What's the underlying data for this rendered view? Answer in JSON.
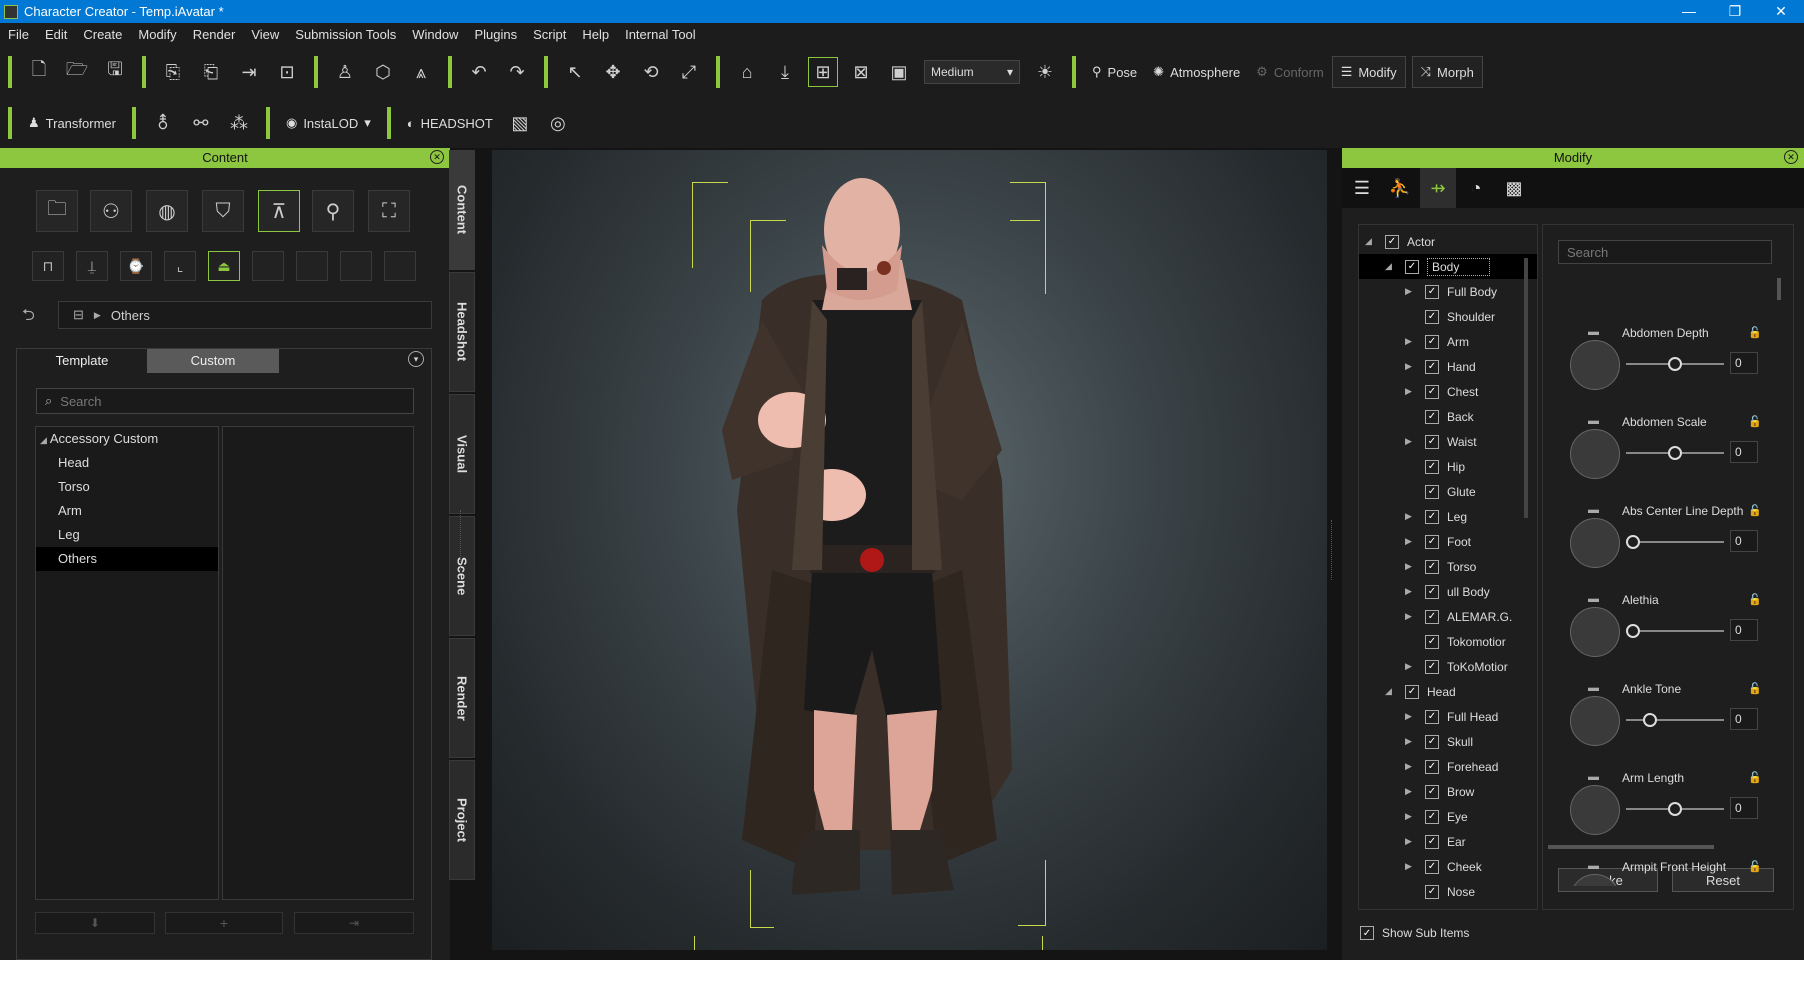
{
  "window": {
    "title": "Character Creator - Temp.iAvatar *",
    "minimize": "—",
    "maximize": "❐",
    "close": "✕"
  },
  "menu": [
    "File",
    "Edit",
    "Create",
    "Modify",
    "Render",
    "View",
    "Submission Tools",
    "Window",
    "Plugins",
    "Script",
    "Help",
    "Internal Tool"
  ],
  "toolbar1": {
    "quality_value": "Medium",
    "pose_label": "Pose",
    "atmosphere_label": "Atmosphere",
    "conform_label": "Conform",
    "modify_label": "Modify",
    "morph_label": "Morph"
  },
  "toolbar2": {
    "transformer_label": "Transformer",
    "instalod_label": "InstaLOD",
    "headshot_label": "HEADSHOT"
  },
  "content_panel": {
    "title": "Content",
    "breadcrumb": "Others",
    "tab_template": "Template",
    "tab_custom": "Custom",
    "search_placeholder": "Search",
    "tree_root": "Accessory Custom",
    "tree_items": [
      "Head",
      "Torso",
      "Arm",
      "Leg",
      "Others"
    ],
    "selected_item": "Others"
  },
  "side_tabs": [
    "Content",
    "Headshot",
    "Visual",
    "Scene",
    "Render",
    "Project"
  ],
  "modify_panel": {
    "title": "Modify",
    "search_placeholder": "Search",
    "tree": [
      {
        "label": "Actor",
        "level": 0,
        "expand": "down"
      },
      {
        "label": "Body",
        "level": 1,
        "expand": "down",
        "selected": true
      },
      {
        "label": "Full Body",
        "level": 2,
        "expand": "right"
      },
      {
        "label": "Shoulder",
        "level": 2,
        "expand": "none"
      },
      {
        "label": "Arm",
        "level": 2,
        "expand": "right"
      },
      {
        "label": "Hand",
        "level": 2,
        "expand": "right"
      },
      {
        "label": "Chest",
        "level": 2,
        "expand": "right"
      },
      {
        "label": "Back",
        "level": 2,
        "expand": "none"
      },
      {
        "label": "Waist",
        "level": 2,
        "expand": "right"
      },
      {
        "label": "Hip",
        "level": 2,
        "expand": "none"
      },
      {
        "label": "Glute",
        "level": 2,
        "expand": "none"
      },
      {
        "label": "Leg",
        "level": 2,
        "expand": "right"
      },
      {
        "label": "Foot",
        "level": 2,
        "expand": "right"
      },
      {
        "label": "Torso",
        "level": 2,
        "expand": "right"
      },
      {
        "label": "ull Body",
        "level": 2,
        "expand": "right"
      },
      {
        "label": "ALEMAR.G.",
        "level": 2,
        "expand": "right"
      },
      {
        "label": "Tokomotior",
        "level": 2,
        "expand": "none"
      },
      {
        "label": "ToKoMotior",
        "level": 2,
        "expand": "right"
      },
      {
        "label": "Head",
        "level": 1,
        "expand": "down"
      },
      {
        "label": "Full Head",
        "level": 2,
        "expand": "right"
      },
      {
        "label": "Skull",
        "level": 2,
        "expand": "right"
      },
      {
        "label": "Forehead",
        "level": 2,
        "expand": "right"
      },
      {
        "label": "Brow",
        "level": 2,
        "expand": "right"
      },
      {
        "label": "Eye",
        "level": 2,
        "expand": "right"
      },
      {
        "label": "Ear",
        "level": 2,
        "expand": "right"
      },
      {
        "label": "Cheek",
        "level": 2,
        "expand": "right"
      },
      {
        "label": "Nose",
        "level": 2,
        "expand": "none"
      }
    ],
    "sliders": [
      {
        "name": "Abdomen Depth",
        "value": "0",
        "level": 0.5
      },
      {
        "name": "Abdomen Scale",
        "value": "0",
        "level": 0.5
      },
      {
        "name": "Abs Center Line Depth",
        "value": "0",
        "level": 0.0
      },
      {
        "name": "Alethia",
        "value": "0",
        "level": 0.0
      },
      {
        "name": "Ankle Tone",
        "value": "0",
        "level": 0.2
      },
      {
        "name": "Arm Length",
        "value": "0",
        "level": 0.5
      },
      {
        "name": "Armpit Front Height",
        "value": "",
        "level": 0.5
      }
    ],
    "bake_label": "Bake",
    "reset_label": "Reset",
    "show_sub_items_label": "Show Sub Items"
  }
}
